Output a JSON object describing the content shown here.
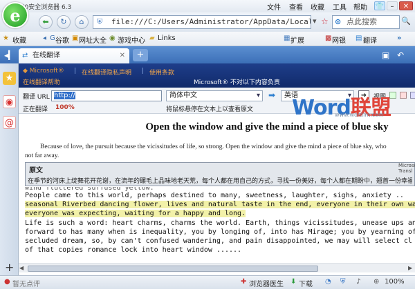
{
  "window": {
    "app_title": "360安全浏览器 6.3",
    "menus": [
      "文件",
      "查看",
      "收藏",
      "工具",
      "帮助"
    ],
    "controls": [
      "–",
      "□",
      "✕"
    ]
  },
  "nav": {
    "address": "file:///C:/Users/Administrator/AppData/Local/Mi",
    "search_placeholder": "点此搜索"
  },
  "bookmarks": {
    "favorites": "收藏",
    "items": [
      "谷歌",
      "网址大全",
      "游戏中心",
      "Links"
    ],
    "right": [
      "扩展",
      "网银",
      "翻译"
    ]
  },
  "tab": {
    "title": "在线翻译",
    "add": "+"
  },
  "translator": {
    "brand": "Microsoft®",
    "links": [
      "在线翻译隐私声明",
      "使用条款"
    ],
    "help": "在线翻译帮助",
    "disclaimer": "Microsoft® 不对以下内容负责",
    "url_label": "翻译 URL",
    "url_value": "http://",
    "source_lang": "简体中文",
    "target_lang": "英语",
    "view_label": "视图",
    "status_label": "正在翻译",
    "progress_text": "100%",
    "progress": 1.0,
    "hover_hint": "将鼠标悬停在文本上以查看原文"
  },
  "watermark": {
    "text": "Word联盟",
    "url": "www.wordlm.com"
  },
  "page": {
    "title": "Open the window and give the mind a piece of blue sky",
    "para1_line1": "Because of love, the pursuit because the vicissitudes of life, so strong. Open the window and give the mind a piece of blue sky, who",
    "para1_line2": "not far away.",
    "popup_title": "原文",
    "popup_brand": "Microsoft",
    "popup_brand2": "Transl",
    "popup_text": "在季节的河床上绽舞花开花谢，在流年的碾毛上品味地老天荒，每个人都在用自己的方式，寻找一份美好，每个人都在期盼中，翘首一份幸福",
    "para2_cut": "wind fluttered suffused yellow.",
    "lines": [
      "     People came to this world, perhaps destined to many, sweetness, laughter, sighs, anxiety ..",
      "seasonal Riverbed dancing flower, lives and natural taste in the end, everyone in their own wa",
      "everyone was expecting, waiting for a happy and long.",
      "     Life is such a word: heart charms, charms the world. Earth, things vicissitudes, unease ups and do",
      "forward to has many when is inequality, you by longing of, into has Mirage; you by yearning of",
      "secluded dream, so, by can't confused wandering, and pain disappointed, we may will select cl",
      "of that copies romance lock into heart window ......"
    ]
  },
  "statusbar": {
    "left": "暂无点评",
    "doctor": "浏览器医生",
    "download": "下载",
    "zoom": "100%"
  }
}
